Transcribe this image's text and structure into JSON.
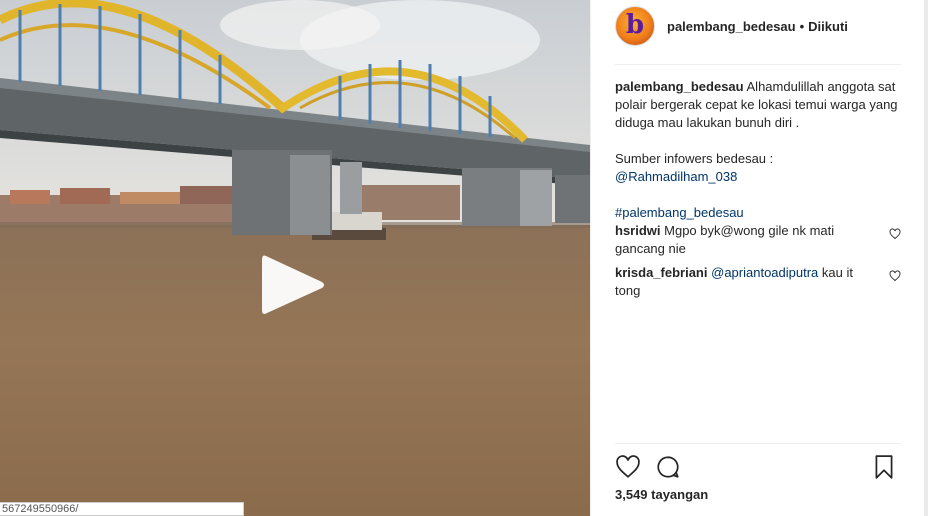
{
  "media": {
    "type": "video",
    "status_url": "567249550966/"
  },
  "header": {
    "avatar_letter": "b",
    "username": "palembang_bedesau",
    "separator": "•",
    "follow_status": "Diikuti"
  },
  "caption": {
    "username": "palembang_bedesau",
    "text": "Alhamdulillah anggota sat polair bergerak cepat ke lokasi temui warga yang diduga mau lakukan bunuh diri .",
    "source_prefix": "Sumber infowers bedesau :",
    "mention": "@Rahmadilham_038",
    "hashtag": "#palembang_bedesau"
  },
  "comments": [
    {
      "username": "hsridwi",
      "text": "Mgpo byk@wong gile nk mati gancang nie",
      "mention": ""
    },
    {
      "username": "krisda_febriani",
      "mention": "@apriantoadiputra",
      "text": "kau it tong"
    }
  ],
  "stats": {
    "views": "3,549 tayangan"
  },
  "icons": [
    "heart-icon",
    "comment-icon",
    "bookmark-icon",
    "play-icon",
    "small-heart-icon"
  ],
  "colors": {
    "link": "#003569",
    "text": "#262626",
    "divider": "#efefef"
  }
}
